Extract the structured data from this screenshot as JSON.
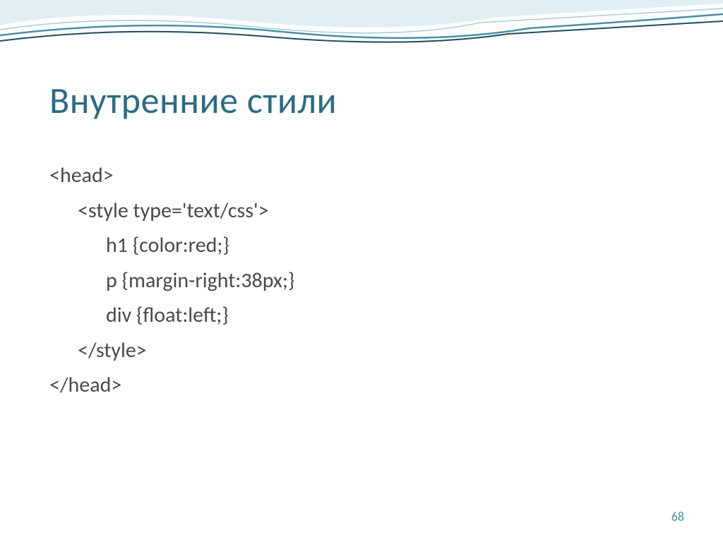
{
  "slide": {
    "title": "Внутренние стили",
    "code": {
      "line1": "<head>",
      "line2": "<style type='text/css'>",
      "line3": "h1 {color:red;}",
      "line4": "p {margin-right:38px;}",
      "line5": "div {float:left;}",
      "line6": "</style>",
      "line7": "</head>"
    },
    "page_number": "68"
  }
}
